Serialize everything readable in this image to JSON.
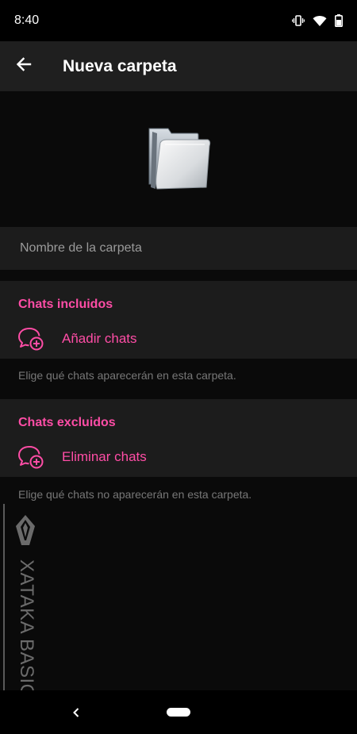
{
  "status_bar": {
    "time": "8:40",
    "icons": [
      "vibrate-icon",
      "wifi-icon",
      "battery-icon"
    ]
  },
  "toolbar": {
    "back_icon": "arrow-back-icon",
    "title": "Nueva carpeta"
  },
  "folder_image": {
    "icon": "folder-icon"
  },
  "name_field": {
    "value": "",
    "placeholder": "Nombre de la carpeta"
  },
  "included": {
    "title": "Chats incluidos",
    "action_label": "Añadir chats",
    "action_icon": "add-chat-icon",
    "hint": "Elige qué chats aparecerán en esta carpeta."
  },
  "excluded": {
    "title": "Chats excluidos",
    "action_label": "Eliminar chats",
    "action_icon": "add-chat-icon",
    "hint": "Elige qué chats no aparecerán en esta carpeta."
  },
  "watermark": {
    "text": "XATAKA BASICS",
    "icon": "xataka-logo-icon"
  },
  "nav_bar": {
    "back_icon": "nav-back-icon",
    "home_icon": "home-pill-icon"
  },
  "colors": {
    "accent": "#ff4da6",
    "background": "#0a0a0a",
    "surface": "#1c1c1c",
    "toolbar": "#1f1f1f"
  }
}
